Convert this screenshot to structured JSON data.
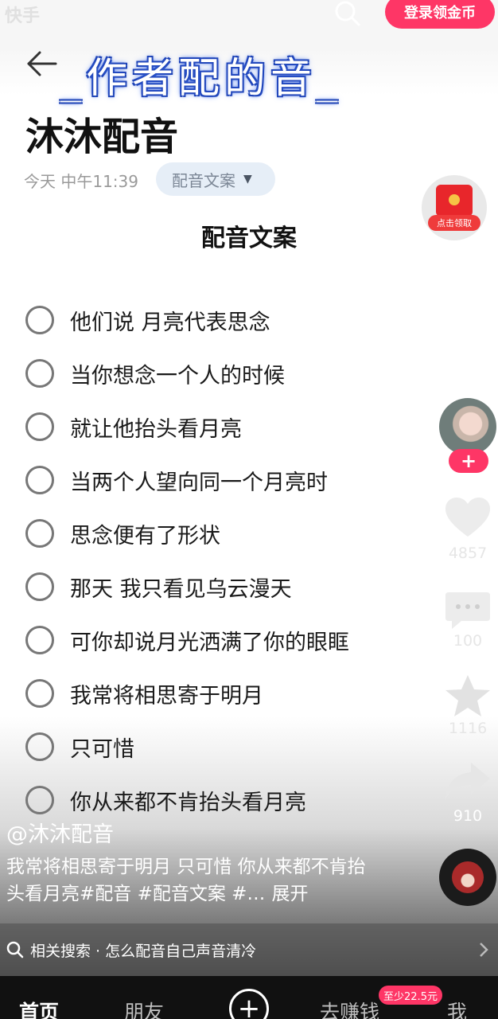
{
  "status": {
    "app_logo": "快手"
  },
  "header": {
    "login_button": "登录领金币",
    "overlay_caption": "_作者配的音_"
  },
  "document": {
    "title": "沐沐配音",
    "time": "今天 中午11:39",
    "tag": "配音文案",
    "section_heading": "配音文案",
    "items": [
      "他们说 月亮代表思念",
      "当你想念一个人的时候",
      "就让他抬头看月亮",
      "当两个人望向同一个月亮时",
      "思念便有了形状",
      "那天 我只看见乌云漫天",
      "可你却说月光洒满了你的眼眶",
      "我常将相思寄于明月",
      "只可惜",
      "你从来都不肯抬头看月亮"
    ]
  },
  "side_rail": {
    "red_packet_label": "点击领取",
    "follow_symbol": "+",
    "likes": "4857",
    "comments": "100",
    "favorites": "1116",
    "shares": "910"
  },
  "caption": {
    "author": "@沐沐配音",
    "text": "我常将相思寄于明月 只可惜 你从来都不肯抬头看月亮#配音 #配音文案 #…",
    "expand": "展开"
  },
  "related_search": {
    "text": "相关搜索 · 怎么配音自己声音清冷"
  },
  "bottom_nav": {
    "home": "首页",
    "friends": "朋友",
    "plus": "+",
    "earn": "去赚钱",
    "earn_badge": "至少22.5元",
    "me": "我"
  },
  "colors": {
    "accent": "#fe3666",
    "tag_bg": "#e6eef7",
    "text": "#111111"
  }
}
